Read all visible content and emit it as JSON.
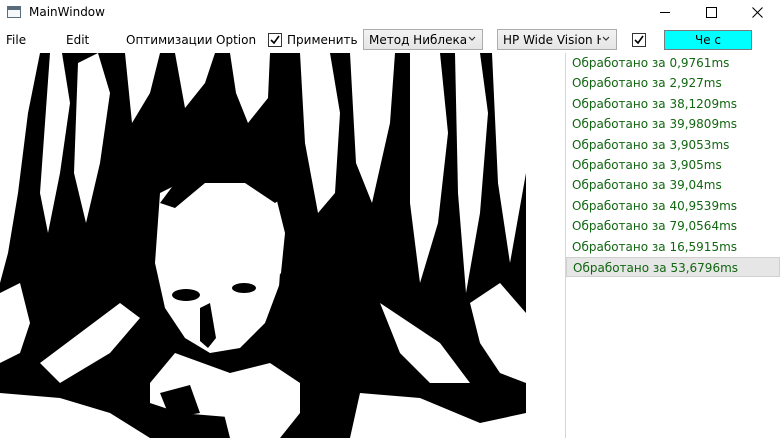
{
  "window": {
    "title": "MainWindow"
  },
  "menu": {
    "file": "File",
    "edit": "Edit",
    "optimizations": "Оптимизации",
    "option": "Option"
  },
  "toolbar": {
    "apply_label": "Применить",
    "apply_checked": true,
    "method_selected": "Метод Ниблека",
    "camera_selected": "HP Wide Vision H",
    "second_checkbox_checked": true,
    "memory_button": "Че с памятью?",
    "memory_button_color": "#00ffff"
  },
  "log": {
    "text_color": "#116611",
    "items": [
      "Обработано за 0,9761ms",
      "Обработано за 2,927ms",
      "Обработано за 38,1209ms",
      "Обработано за 39,9809ms",
      "Обработано за 3,9053ms",
      "Обработано за 3,905ms",
      "Обработано за 39,04ms",
      "Обработано за 40,9539ms",
      "Обработано за 79,0564ms",
      "Обработано за 16,5915ms",
      "Обработано за 53,6796ms"
    ],
    "selected_index": 10
  },
  "icons": {
    "app": "window-icon",
    "minimize": "minimize-icon",
    "maximize": "maximize-icon",
    "close": "close-icon",
    "check": "checkmark-icon",
    "dropdown": "chevron-down-icon"
  }
}
